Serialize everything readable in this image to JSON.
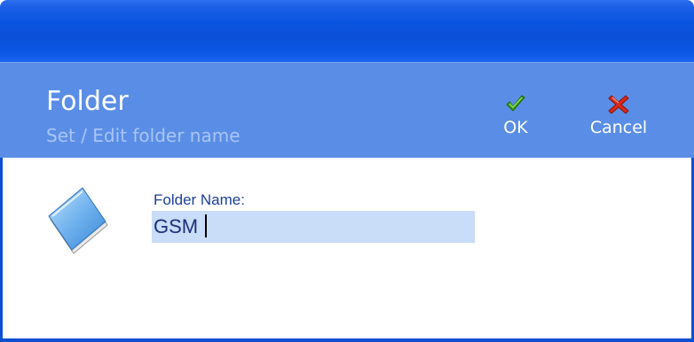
{
  "dialog": {
    "title": "Folder",
    "subtitle": "Set / Edit folder name"
  },
  "toolbar": {
    "ok_label": "OK",
    "cancel_label": "Cancel"
  },
  "form": {
    "folder_name_label": "Folder Name:",
    "folder_name_value": "GSM"
  },
  "icons": {
    "ok": "checkmark-icon",
    "cancel": "close-icon",
    "folder": "folder-icon"
  },
  "colors": {
    "titlebar": "#0a55e0",
    "header": "#5a8ee6",
    "subtitle": "#a9c5f5",
    "input_bg": "#c9dcf8",
    "ok_green": "#3a9a1a",
    "cancel_red": "#d8281a"
  }
}
